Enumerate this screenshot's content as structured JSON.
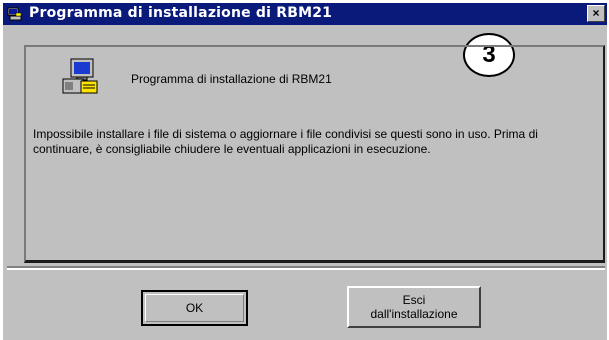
{
  "window": {
    "title": "Programma di installazione di RBM21",
    "close_glyph": "×"
  },
  "badge": {
    "number": "3"
  },
  "dialog": {
    "header": "Programma di installazione di RBM21",
    "message": "Impossibile installare i file di sistema o aggiornare i file condivisi se questi sono in uso. Prima di continuare, è consigliabile chiudere le eventuali applicazioni in esecuzione."
  },
  "buttons": {
    "ok_label": "OK",
    "exit_line1": "Esci",
    "exit_line2": "dall'installazione"
  },
  "icons": {
    "title_icon": "setup-computer-icon",
    "app_icon": "setup-computer-icon"
  },
  "colors": {
    "titlebar": "#0a1a7a",
    "face": "#c0c0c0"
  }
}
